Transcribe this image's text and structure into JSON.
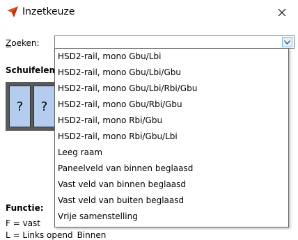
{
  "window": {
    "title": "Inzetkeuze",
    "icon": "arrow-cursor-icon",
    "close_icon": "close-icon"
  },
  "search": {
    "label_first": "Z",
    "label_rest": "oeken:",
    "value": "",
    "button_icon": "chevron-down-icon"
  },
  "section": {
    "label": "Schuifelement"
  },
  "preview": {
    "panes": [
      "?",
      "?"
    ]
  },
  "dropdown": {
    "items": [
      "HSD2-rail, mono Gbu/Lbi",
      "HSD2-rail, mono Gbu/Lbi/Gbu",
      "HSD2-rail, mono Gbu/Lbi/Rbi/Gbu",
      "HSD2-rail, mono Gbu/Rbi/Gbu",
      "HSD2-rail, mono Rbi/Gbu",
      "HSD2-rail, mono Rbi/Gbu/Lbi",
      "Leeg raam",
      "Paneelveld van binnen beglaasd",
      "Vast veld van binnen beglaasd",
      "Vast veld van buiten beglaasd",
      "Vrije samenstelling"
    ]
  },
  "function": {
    "label": "Functie:",
    "line1": "F = vast",
    "line2a": "L = Links opend",
    "line2b": "Binnen"
  },
  "colors": {
    "accent": "#e8501c",
    "pane": "#b4cdef",
    "frame": "#5a5a5a",
    "combo_button": "#e5f1fb"
  }
}
